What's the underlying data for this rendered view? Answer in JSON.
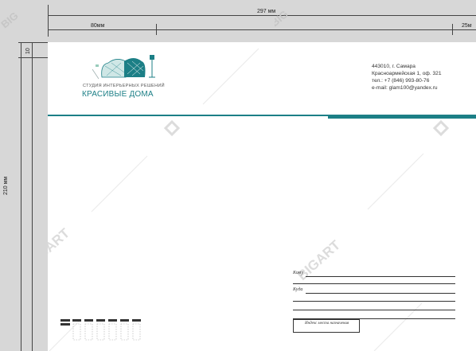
{
  "dimensions": {
    "width_label": "297 мм",
    "left_margin_label": "80мм",
    "right_margin_label": "25м",
    "height_label": "210 мм",
    "top_margin_label": "10"
  },
  "logo": {
    "subtitle": "СТУДИЯ ИНТЕРЬЕРНЫХ РЕШЕНИЙ",
    "title": "КРАСИВЫЕ ДОМА"
  },
  "sender_address": {
    "line1": "443010, г. Самара",
    "line2": "Красноармейская 1, оф. 321",
    "line3": "тел.: +7 (846) 993-80-76",
    "line4": "e-mail: glam100@yandex.ru"
  },
  "recipient_fields": {
    "to_whom_label": "Кому",
    "where_label": "Куда",
    "postal_code_label": "Индекс места назначения"
  },
  "watermark": {
    "text": "BIGART"
  },
  "colors": {
    "accent": "#1c7f86",
    "background": "#d7d7d7"
  }
}
